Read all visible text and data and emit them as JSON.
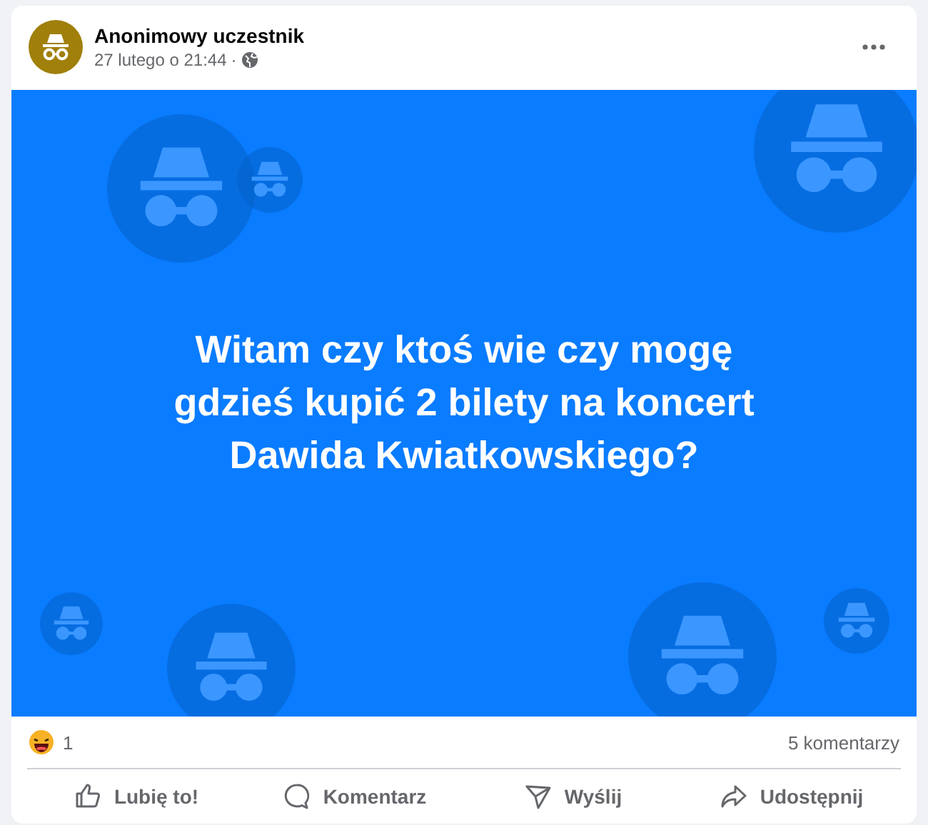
{
  "post": {
    "author": "Anonimowy uczestnik",
    "time": "27 lutego o 21:44",
    "separator": "·",
    "text": "Witam czy ktoś wie czy mogę gdzieś kupić 2 bilety na koncert Dawida Kwiatkowskiego?"
  },
  "reactions": {
    "count": "1",
    "comments": "5 komentarzy"
  },
  "actions": [
    {
      "kind": "like",
      "label": "Lubię to!"
    },
    {
      "kind": "comment",
      "label": "Komentarz"
    },
    {
      "kind": "send",
      "label": "Wyślij"
    },
    {
      "kind": "share",
      "label": "Udostępnij"
    }
  ]
}
